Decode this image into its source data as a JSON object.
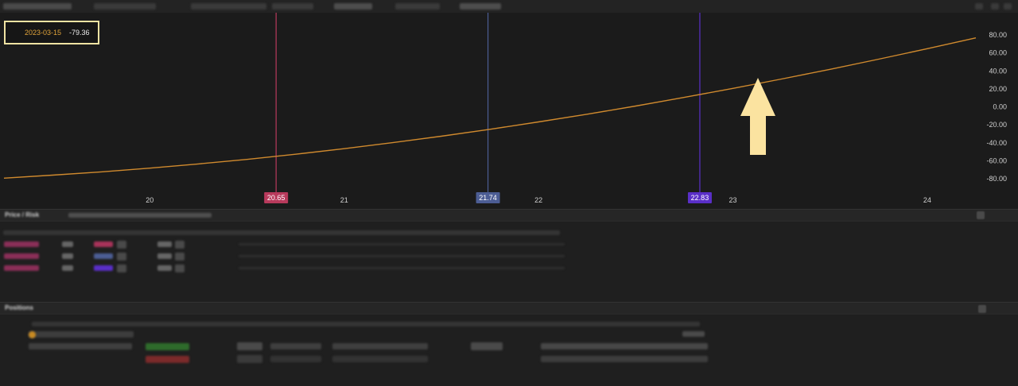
{
  "toolbar": {
    "items": [
      "",
      "",
      "",
      "",
      "",
      "",
      "",
      ""
    ]
  },
  "tooltip": {
    "date": "2023-03-15",
    "value": "-79.36"
  },
  "chart_data": {
    "type": "line",
    "x_ticks": [
      "20",
      "21",
      "22",
      "23",
      "24"
    ],
    "x_range": [
      19.25,
      24.25
    ],
    "y_ticks": [
      "80.00",
      "60.00",
      "40.00",
      "20.00",
      "0.00",
      "-20.00",
      "-40.00",
      "-60.00",
      "-80.00"
    ],
    "y_range": [
      -88,
      88
    ],
    "series": [
      {
        "color": "#d08a2e",
        "x": [
          19.25,
          19.5,
          19.75,
          20.0,
          20.25,
          20.5,
          20.75,
          21.0,
          21.25,
          21.5,
          21.75,
          22.0,
          22.25,
          22.5,
          22.75,
          23.0,
          23.25,
          23.5,
          23.75,
          24.0,
          24.25
        ],
        "y": [
          -79.4,
          -76.0,
          -72.4,
          -68.2,
          -63.6,
          -58.5,
          -52.8,
          -46.6,
          -39.9,
          -32.7,
          -25.0,
          -16.8,
          -8.2,
          0.9,
          10.5,
          20.5,
          30.9,
          41.7,
          53.0,
          64.7,
          76.7
        ]
      }
    ],
    "markers": [
      {
        "label": "20.65",
        "x": 20.65,
        "color": "#b83a5c"
      },
      {
        "label": "21.74",
        "x": 21.74,
        "color": "#4c5d94"
      },
      {
        "label": "22.83",
        "x": 22.83,
        "color": "#5a2fc8"
      }
    ]
  },
  "legs_panel": {
    "title": "",
    "rows": 3
  },
  "positions_panel": {
    "title": "",
    "rows": 3
  },
  "annotation": {
    "arrow": "up-arrow-icon",
    "color": "#fbe3a0"
  }
}
